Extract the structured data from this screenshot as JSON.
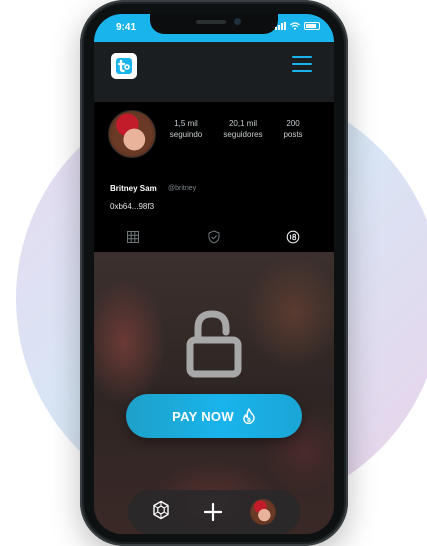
{
  "status": {
    "time": "9:41"
  },
  "profile": {
    "stats": [
      {
        "num": "1,5 mil",
        "label": "seguindo"
      },
      {
        "num": "20,1 mil",
        "label": "seguidores"
      },
      {
        "num": "200",
        "label": "posts"
      }
    ],
    "name": "Britney Sam",
    "handle": "@britney",
    "wallet": "0xb64...98f3"
  },
  "tabs": [
    "grid-icon",
    "shield-check-icon",
    "age-18-icon"
  ],
  "content": {
    "pay_label": "PAY NOW"
  },
  "bottom_nav": [
    "hexagon-icon",
    "plus-icon",
    "avatar"
  ],
  "colors": {
    "accent": "#19b4ec",
    "button": "#1aa6d6"
  }
}
